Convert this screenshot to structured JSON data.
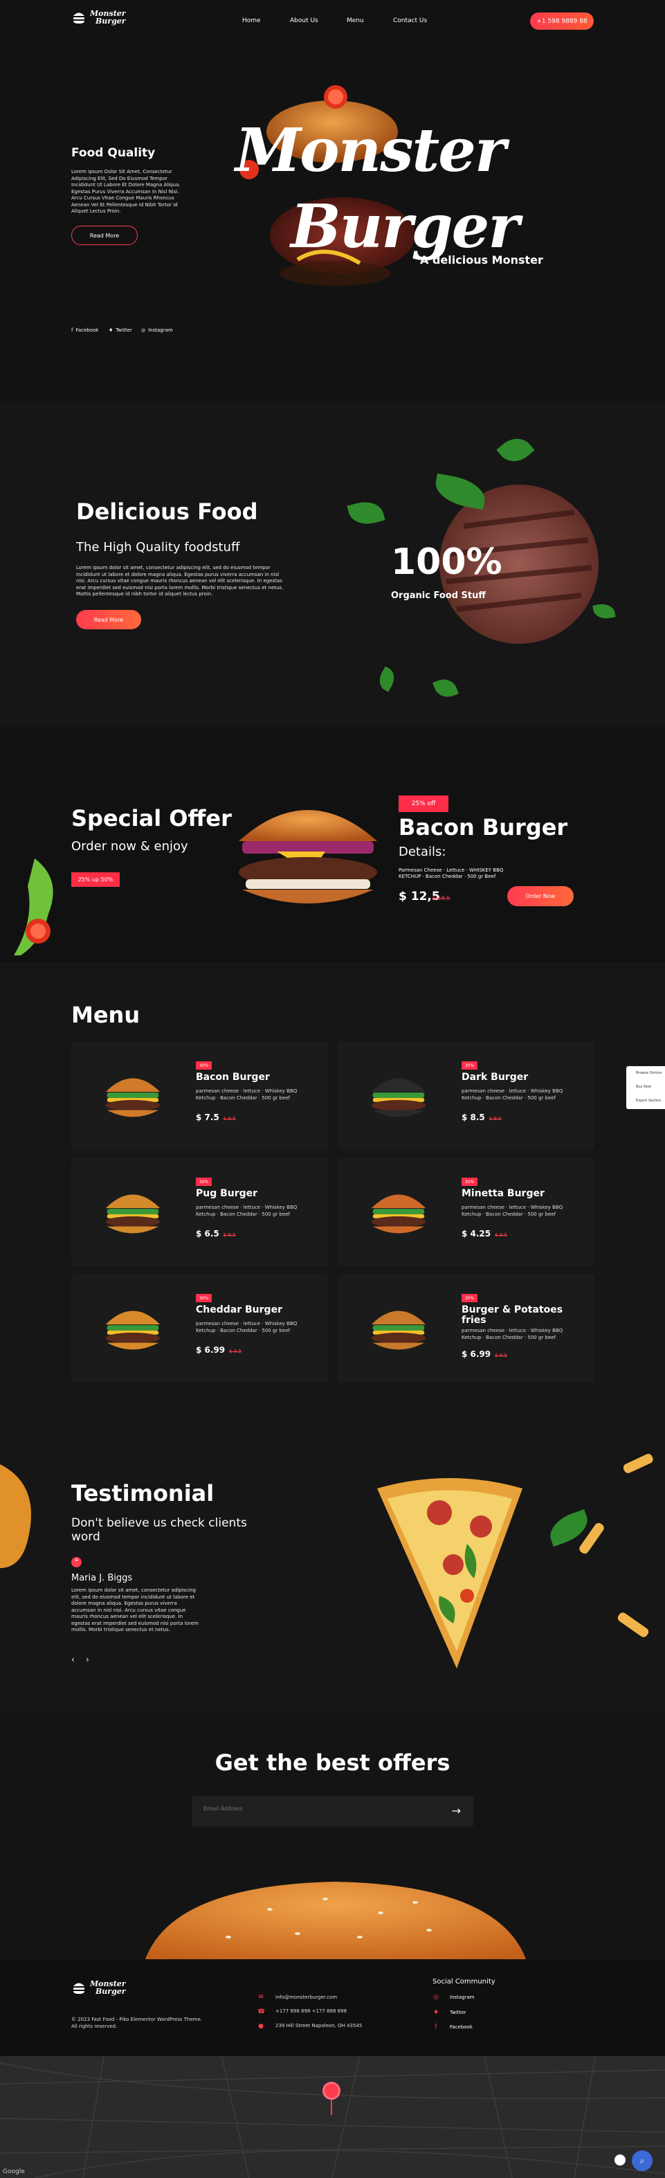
{
  "brand": {
    "logo_line1": "Monster",
    "logo_line2": "Burger"
  },
  "nav": {
    "items": [
      "Home",
      "About Us",
      "Menu",
      "Contact Us"
    ],
    "phone": "+1 598 9889 88"
  },
  "hero": {
    "eyebrow": "Food Quality",
    "text": "Lorem Ipsum Dolor Sit Amet, Consectetur Adipiscing Elit, Sed Do Eiusmod Tempor Incididunt Ut Labore Et Dolore Magna Aliqua. Egestas Purus Viverra Accumsan In Nisl Nisi. Arcu Cursus Vitae Congue Mauris Rhoncus Aenean Vel Et Pellentesque Id Nibh Tortor Id Aliquet Lectus Proin.",
    "button": "Read More",
    "title_line1": "Monster",
    "title_line2": "Burger",
    "tagline": "A delicious Monster",
    "social": [
      "Facebook",
      "Twitter",
      "Instagram"
    ]
  },
  "delicious": {
    "title": "Delicious Food",
    "subtitle": "The High Quality foodstuff",
    "text": "Lorem ipsum dolor sit amet, consectetur adipiscing elit, sed do eiusmod tempor incididunt ut labore et dolore magna aliqua. Egestas purus viverra accumsan in nisl nisi. Arcu cursus vitae congue mauris rhoncus aenean vel elit scelerisque. In egestas erat imperdiet sed euismod nisi porta lorem mollis. Morbi tristique senectus et netus. Mattis pellentesque id nibh tortor id aliquet lectus proin.",
    "button": "Read More",
    "percent": "100%",
    "percent_label": "Organic Food Stuff"
  },
  "special": {
    "title": "Special Offer",
    "subtitle": "Order now & enjoy",
    "badge": "25% up 50%",
    "off_badge": "25% off",
    "product": "Bacon Burger",
    "details_label": "Details:",
    "details": "Parmesan Cheese · Lettuce · WHISKEY BBQ KETCHUP · Bacon Cheddar · 500 gr Beef",
    "price": "$ 12,5",
    "old_price": "$ 18,5",
    "button": "Order Now"
  },
  "menu": {
    "title": "Menu",
    "items": [
      {
        "badge": "30%",
        "name": "Bacon Burger",
        "desc": "parmesan cheese · lettuce · Whiskey BBQ Ketchup · Bacon Cheddar · 500 gr beef",
        "price": "$ 7.5",
        "old": "$ 9.5"
      },
      {
        "badge": "30%",
        "name": "Dark Burger",
        "desc": "parmesan cheese · lettuce · Whiskey BBQ Ketchup · Bacon Cheddar · 500 gr beef",
        "price": "$ 8.5",
        "old": "$ 9.5"
      },
      {
        "badge": "30%",
        "name": "Pug Burger",
        "desc": "parmesan cheese · lettuce · Whiskey BBQ Ketchup · Bacon Cheddar · 500 gr beef",
        "price": "$ 6.5",
        "old": "$ 9.5"
      },
      {
        "badge": "30%",
        "name": "Minetta Burger",
        "desc": "parmesan cheese · lettuce · Whiskey BBQ Ketchup · Bacon Cheddar · 500 gr beef",
        "price": "$ 4.25",
        "old": "$ 9.5"
      },
      {
        "badge": "30%",
        "name": "Cheddar Burger",
        "desc": "parmesan cheese · lettuce · Whiskey BBQ Ketchup · Bacon Cheddar · 500 gr beef",
        "price": "$ 6.99",
        "old": "$ 9.5"
      },
      {
        "badge": "30%",
        "name": "Burger & Potatoes fries",
        "desc": "parmesan cheese · lettuce · Whiskey BBQ Ketchup · Bacon Cheddar · 500 gr beef",
        "price": "$ 6.99",
        "old": "$ 9.5"
      }
    ]
  },
  "side_panel": [
    "Browse Demos",
    "Buy Now",
    "Export Section"
  ],
  "testimonial": {
    "title": "Testimonial",
    "subtitle": "Don't believe us check clients word",
    "name": "Maria J. Biggs",
    "text": "Lorem ipsum dolor sit amet, consectetur adipiscing elit, sed do eiusmod tempor incididunt ut labore et dolore magna aliqua. Egestas purus viverra accumsan in nisl nisi. Arcu cursus vitae congue mauris rhoncus aenean vel elit scelerisque. In egestas erat imperdiet sed euismod nisi porta lorem mollis. Morbi tristique senectus et netus."
  },
  "offers": {
    "title": "Get the best offers",
    "placeholder": "Email Address"
  },
  "footer": {
    "copyright": "© 2023 Fast Food - Piko Elementor WordPress Theme. All rights reserved.",
    "email": "info@monsterburger.com",
    "phone": "+177 898 898 +177 898 898",
    "address": "239 Hill Street Napoleon, OH 43545",
    "social_title": "Social Community",
    "social": [
      "Instagram",
      "Twitter",
      "Facebook"
    ]
  },
  "map": {
    "google": "Google"
  },
  "colors": {
    "accent": "#ff3b4e",
    "bg": "#161616",
    "leaf": "#2f8a2b"
  }
}
